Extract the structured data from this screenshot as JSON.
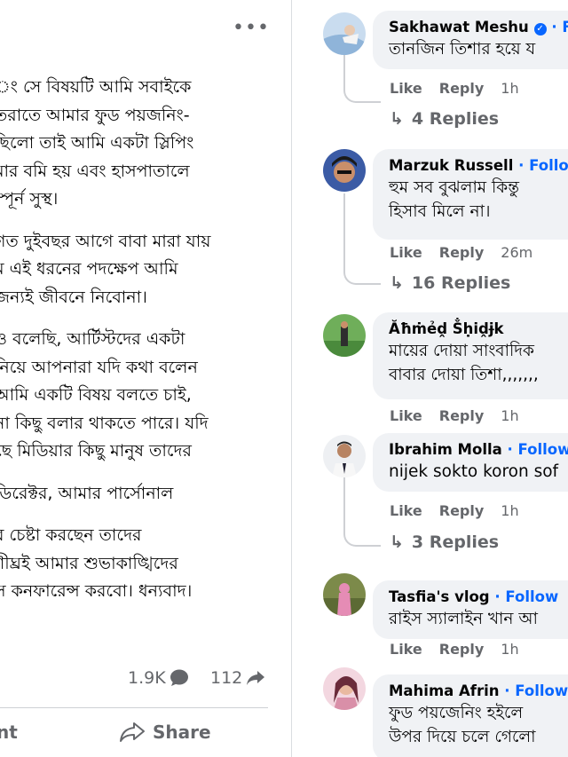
{
  "post": {
    "more_icon": "more-horizontal-icon",
    "paragraphs": [
      [
        "ং সে বিষয়টি আমি সবাইকে",
        "তরাতে আমার ফুড পয়জনিং-",
        " ছিলো তাই আমি একটা স্লিপিং",
        "মার বমি হয় এবং হাসপাতালে",
        "ম্পূর্ন সুস্থ।"
      ],
      [
        "গত দুইবছর আগে বাবা মারা যায়",
        "ম এই ধরনের পদক্ষেপ আমি",
        " জন্যই জীবনে নিবোনা।"
      ],
      [
        "ও বলেছি, আর্টিস্টদের একটা",
        " নিয়ে আপনারা যদি কথা বলেন",
        "আমি একটি বিষয় বলতে চাই,",
        "না কিছু বলার থাকতে পারে। যদি",
        "ছে মিডিয়ার কিছু মানুষ তাদের"
      ],
      [
        "ডিরেক্টর, আমার পার্সোনাল"
      ],
      [
        "র চেষ্টা করছেন তাদের",
        "শীঘ্রই আমার শুভাকাঙ্খিদের",
        "স কনফারেন্স করবো। ধন্যবাদ।"
      ]
    ],
    "reactions_count": "1.9K",
    "shares_count": "112",
    "comment_action": "nt",
    "share_action": "Share"
  },
  "comments": [
    {
      "name": "Sakhawat Meshu",
      "verified": true,
      "follow": "Fo",
      "lines": [
        "তানজিন তিশার হয়ে য"
      ],
      "like": "Like",
      "reply": "Reply",
      "time": "1h",
      "replies": "4 Replies",
      "avatar_color": "#8fb4d9"
    },
    {
      "name": "Marzuk Russell",
      "follow": "Follow",
      "lines": [
        "হুম সব বুঝলাম কিন্তু ",
        "হিসাব মিলে না।"
      ],
      "like": "Like",
      "reply": "Reply",
      "time": "26m",
      "replies": "16 Replies",
      "avatar_color": "#3b5ba5"
    },
    {
      "name": "Ăħṁẻḓ Ṧḥiḓɉk",
      "follow": "",
      "lines": [
        "মায়ের দোয়া সাংবাদিক",
        "বাবার দোয়া তিশা,,,,,,,"
      ],
      "like": "Like",
      "reply": "Reply",
      "time": "1h",
      "replies": "",
      "avatar_color": "#4a8a3c"
    },
    {
      "name": "Ibrahim Molla",
      "follow": "Follow",
      "lines": [
        "nijek sokto koron sof"
      ],
      "like": "Like",
      "reply": "Reply",
      "time": "1h",
      "replies": "3 Replies",
      "avatar_color": "#d8dce2"
    },
    {
      "name": "Tasfia's vlog",
      "follow": "Follow",
      "lines": [
        "রাইস স্যালাইন খান আ"
      ],
      "like": "Like",
      "reply": "Reply",
      "time": "1h",
      "replies": "",
      "avatar_color": "#7c8a4a"
    },
    {
      "name": "Mahima Afrin",
      "follow": "Follow",
      "lines": [
        "ফুড পয়জেনিং হইলে",
        "উপর দিয়ে চলে গেলো"
      ],
      "like": "",
      "reply": "",
      "time": "",
      "replies": "",
      "avatar_color": "#d98fa8"
    }
  ]
}
